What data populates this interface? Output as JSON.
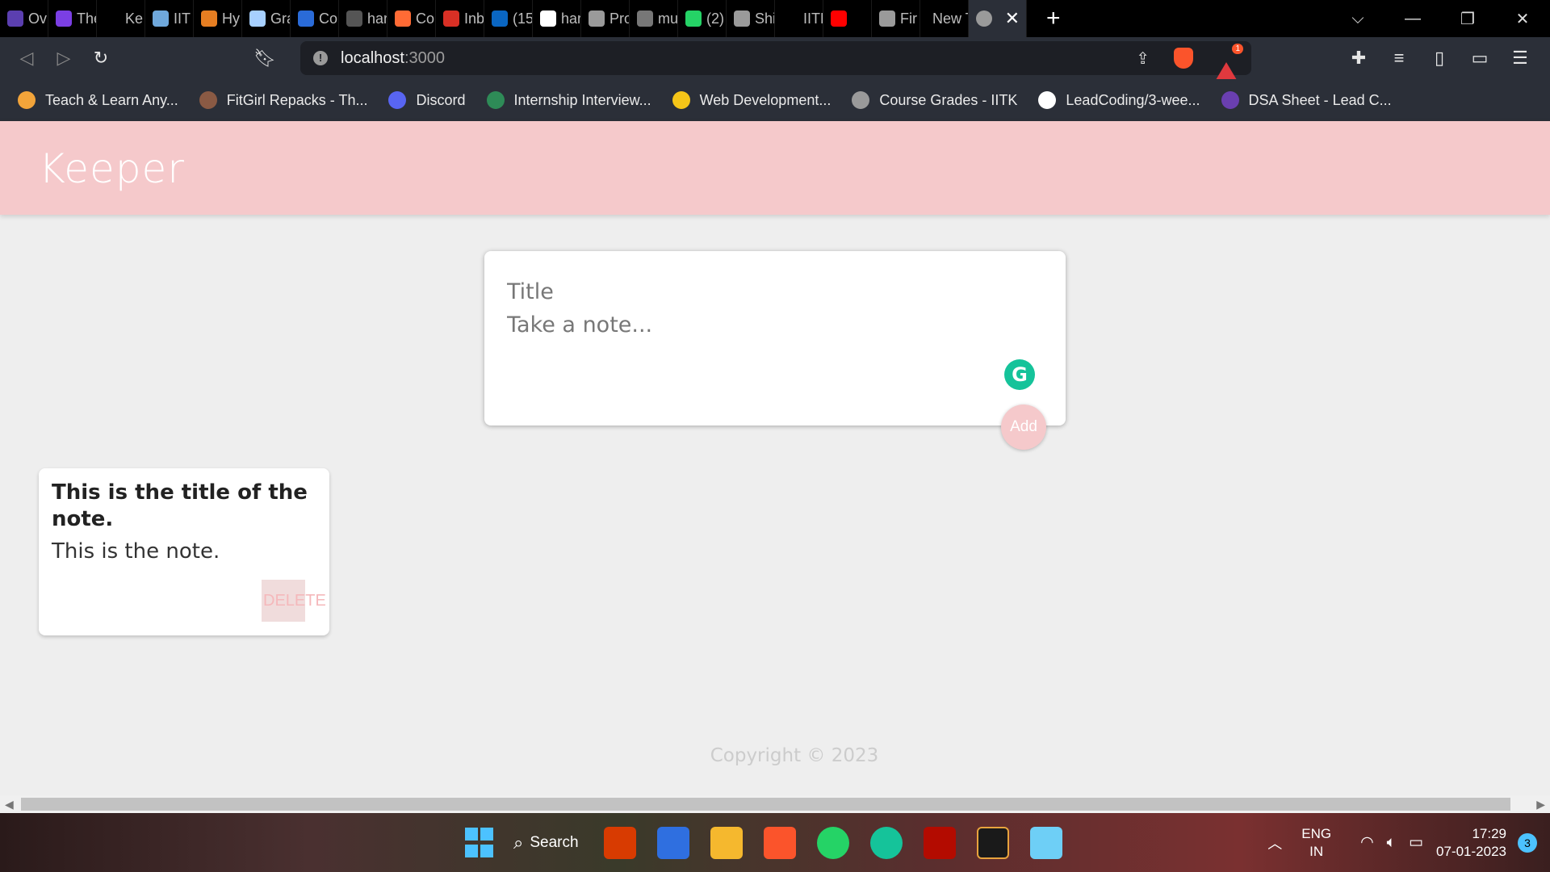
{
  "browser": {
    "tabs": [
      {
        "label": "Ov",
        "icon": "eye-app-icon",
        "color": "#5b3fb0"
      },
      {
        "label": "The",
        "icon": "u-badge-icon",
        "color": "#7b3fe4"
      },
      {
        "label": "Ke",
        "icon": "square-outline-icon",
        "color": "#000000"
      },
      {
        "label": "IIT",
        "icon": "cube-icon",
        "color": "#6fa8dc"
      },
      {
        "label": "Hy",
        "icon": "wave-icon",
        "color": "#e67e22"
      },
      {
        "label": "Gra",
        "icon": "mountain-icon",
        "color": "#a7d0ff"
      },
      {
        "label": "Co",
        "icon": "bar-chart-icon",
        "color": "#2a6bd8"
      },
      {
        "label": "har",
        "icon": "cc-icon",
        "color": "#555555"
      },
      {
        "label": "Co",
        "icon": "chat-icon",
        "color": "#ff6b35"
      },
      {
        "label": "Inb",
        "icon": "gmail-icon",
        "color": "#d93025"
      },
      {
        "label": "(15",
        "icon": "linkedin-icon",
        "color": "#0a66c2"
      },
      {
        "label": "har",
        "icon": "github-icon",
        "color": "#ffffff"
      },
      {
        "label": "Pro",
        "icon": "globe-icon",
        "color": "#9a9a9a"
      },
      {
        "label": "mu",
        "icon": "document-icon",
        "color": "#777777"
      },
      {
        "label": "(2)",
        "icon": "whatsapp-badge-icon",
        "color": "#25d366"
      },
      {
        "label": "Shi",
        "icon": "globe-icon",
        "color": "#9a9a9a"
      },
      {
        "label": "IITH",
        "icon": "blank-icon",
        "color": "#000000"
      },
      {
        "label": "",
        "icon": "youtube-icon",
        "color": "#ff0000"
      },
      {
        "label": "Fir",
        "icon": "globe-icon",
        "color": "#9a9a9a"
      },
      {
        "label": "New Ta",
        "icon": "none",
        "color": "#000000"
      }
    ],
    "active_tab_icon": "globe-icon",
    "active_tab_close": "✕",
    "new_tab_symbol": "+",
    "window_controls": {
      "dropdown": "⌵",
      "minimize": "—",
      "restore": "❐",
      "close": "✕"
    },
    "url_host": "localhost",
    "url_port": ":3000",
    "bookmarks": [
      {
        "label": "Teach & Learn Any...",
        "color": "#f2a43a"
      },
      {
        "label": "FitGirl Repacks - Th...",
        "color": "#8a5a44"
      },
      {
        "label": "Discord",
        "color": "#5865f2"
      },
      {
        "label": "Internship Interview...",
        "color": "#2e8b57"
      },
      {
        "label": "Web Development...",
        "color": "#f5c518"
      },
      {
        "label": "Course Grades - IITK",
        "color": "#9a9a9a"
      },
      {
        "label": "LeadCoding/3-wee...",
        "color": "#ffffff"
      },
      {
        "label": "DSA Sheet - Lead C...",
        "color": "#6a3fb0"
      }
    ]
  },
  "app": {
    "title": "Keeper",
    "create": {
      "title_placeholder": "Title",
      "content_placeholder": "Take a note...",
      "add_label": "Add",
      "grammarly_glyph": "G"
    },
    "notes": [
      {
        "title": "This is the title of the note.",
        "content": "This is the note.",
        "delete_label": "DELETE"
      }
    ],
    "footer": "Copyright © 2023",
    "accent_color": "#f5c9cb"
  },
  "taskbar": {
    "search_label": "Search",
    "apps": [
      "office-icon",
      "editor-icon",
      "file-explorer-icon",
      "brave-icon",
      "whatsapp-icon",
      "grammarly-icon",
      "pdf-icon",
      "terminal-icon",
      "notepad-icon"
    ],
    "lang_top": "ENG",
    "lang_bottom": "IN",
    "time": "17:29",
    "date": "07-01-2023",
    "notifications": "3"
  }
}
